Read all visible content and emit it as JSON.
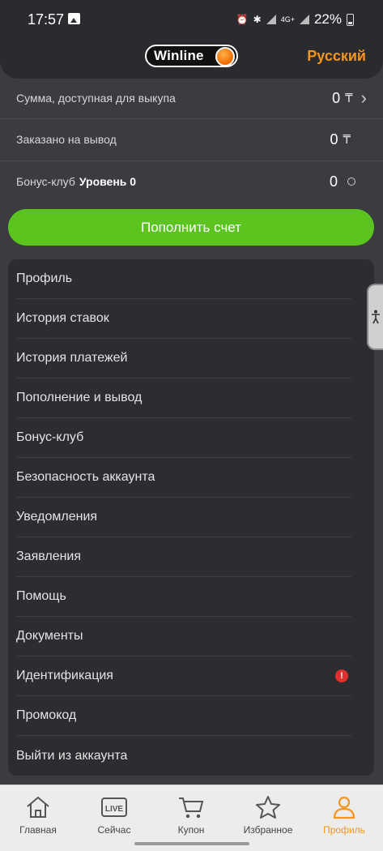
{
  "status_bar": {
    "time": "17:57",
    "network": "4G+",
    "battery": "22%"
  },
  "header": {
    "brand": "Winline",
    "language": "Русский"
  },
  "balances": [
    {
      "label": "Сумма, доступная для выкупа",
      "value": "0",
      "currency": "₸"
    },
    {
      "label": "Заказано на вывод",
      "value": "0",
      "currency": "₸"
    }
  ],
  "bonus": {
    "label": "Бонус-клуб",
    "level": "Уровень 0",
    "value": "0"
  },
  "deposit_button": "Пополнить счет",
  "menu": [
    "Профиль",
    "История ставок",
    "История платежей",
    "Пополнение и вывод",
    "Бонус-клуб",
    "Безопасность аккаунта",
    "Уведомления",
    "Заявления",
    "Помощь",
    "Документы",
    "Идентификация",
    "Промокод",
    "Выйти из аккаунта"
  ],
  "identification_alert": "!",
  "bottom_nav": [
    {
      "label": "Главная",
      "icon": "home-icon"
    },
    {
      "label": "Сейчас",
      "icon": "live-icon",
      "badge": "LIVE"
    },
    {
      "label": "Купон",
      "icon": "cart-icon"
    },
    {
      "label": "Избранное",
      "icon": "star-icon"
    },
    {
      "label": "Профиль",
      "icon": "person-icon",
      "active": true
    }
  ],
  "colors": {
    "accent": "#f5941e",
    "deposit": "#5bc41f",
    "alert": "#e02f2f"
  }
}
